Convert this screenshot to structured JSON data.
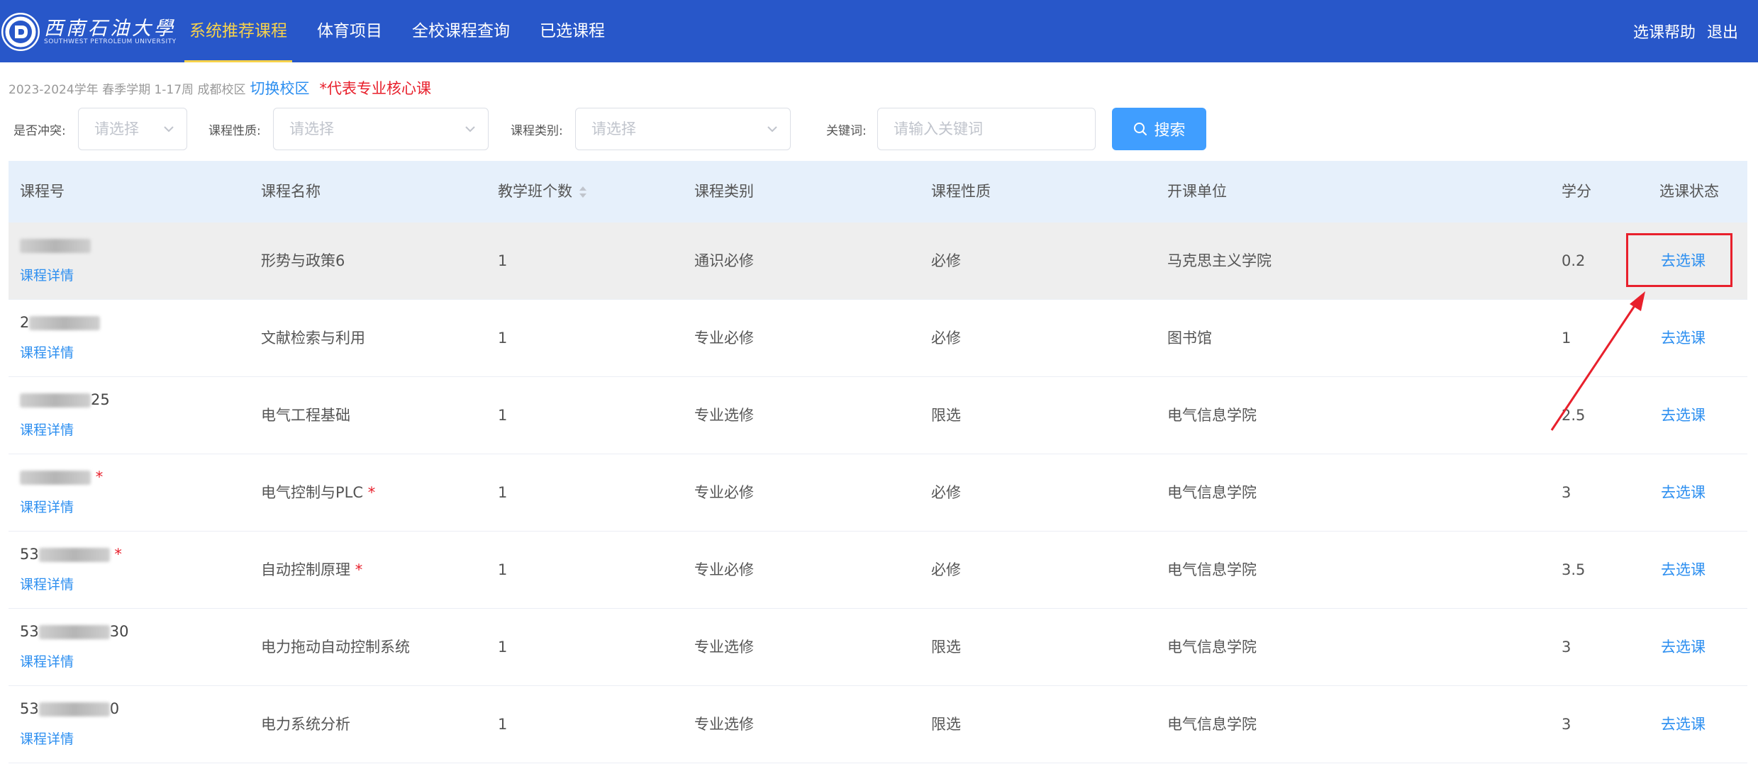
{
  "header": {
    "logo_cn": "西南石油大學",
    "logo_en": "SOUTHWEST PETROLEUM UNIVERSITY",
    "nav": [
      {
        "label": "系统推荐课程",
        "active": true
      },
      {
        "label": "体育项目",
        "active": false
      },
      {
        "label": "全校课程查询",
        "active": false
      },
      {
        "label": "已选课程",
        "active": false
      }
    ],
    "help": "选课帮助",
    "logout": "退出"
  },
  "info": {
    "term": "2023-2024学年 春季学期   1-17周   成都校区",
    "switch_campus": "切换校区",
    "core_note": "*代表专业核心课"
  },
  "filters": {
    "conflict_label": "是否冲突:",
    "conflict_placeholder": "请选择",
    "nature_label": "课程性质:",
    "nature_placeholder": "请选择",
    "category_label": "课程类别:",
    "category_placeholder": "请选择",
    "keyword_label": "关键词:",
    "keyword_placeholder": "请输入关键词",
    "search_label": "搜索"
  },
  "table": {
    "columns": [
      "课程号",
      "课程名称",
      "教学班个数",
      "课程类别",
      "课程性质",
      "开课单位",
      "学分",
      "选课状态"
    ],
    "detail_label": "课程详情",
    "rows": [
      {
        "code_prefix": "",
        "code_suffix": "",
        "core": false,
        "name": "形势与政策6",
        "classes": "1",
        "category": "通识必修",
        "nature": "必修",
        "dept": "马克思主义学院",
        "credit": "0.2",
        "action": "去选课"
      },
      {
        "code_prefix": "2",
        "code_suffix": "",
        "core": false,
        "name": "文献检索与利用",
        "classes": "1",
        "category": "专业必修",
        "nature": "必修",
        "dept": "图书馆",
        "credit": "1",
        "action": "去选课"
      },
      {
        "code_prefix": "",
        "code_suffix": "25",
        "core": false,
        "name": "电气工程基础",
        "classes": "1",
        "category": "专业选修",
        "nature": "限选",
        "dept": "电气信息学院",
        "credit": "2.5",
        "action": "去选课"
      },
      {
        "code_prefix": "",
        "code_suffix": "",
        "core": true,
        "name": "电气控制与PLC",
        "classes": "1",
        "category": "专业必修",
        "nature": "必修",
        "dept": "电气信息学院",
        "credit": "3",
        "action": "去选课"
      },
      {
        "code_prefix": "53",
        "code_suffix": "",
        "core": true,
        "name": "自动控制原理",
        "classes": "1",
        "category": "专业必修",
        "nature": "必修",
        "dept": "电气信息学院",
        "credit": "3.5",
        "action": "去选课"
      },
      {
        "code_prefix": "53",
        "code_suffix": "30",
        "core": false,
        "name": "电力拖动自动控制系统",
        "classes": "1",
        "category": "专业选修",
        "nature": "限选",
        "dept": "电气信息学院",
        "credit": "3",
        "action": "去选课"
      },
      {
        "code_prefix": "53",
        "code_suffix": "0",
        "core": false,
        "name": "电力系统分析",
        "classes": "1",
        "category": "专业选修",
        "nature": "限选",
        "dept": "电气信息学院",
        "credit": "3",
        "action": "去选课"
      }
    ]
  }
}
